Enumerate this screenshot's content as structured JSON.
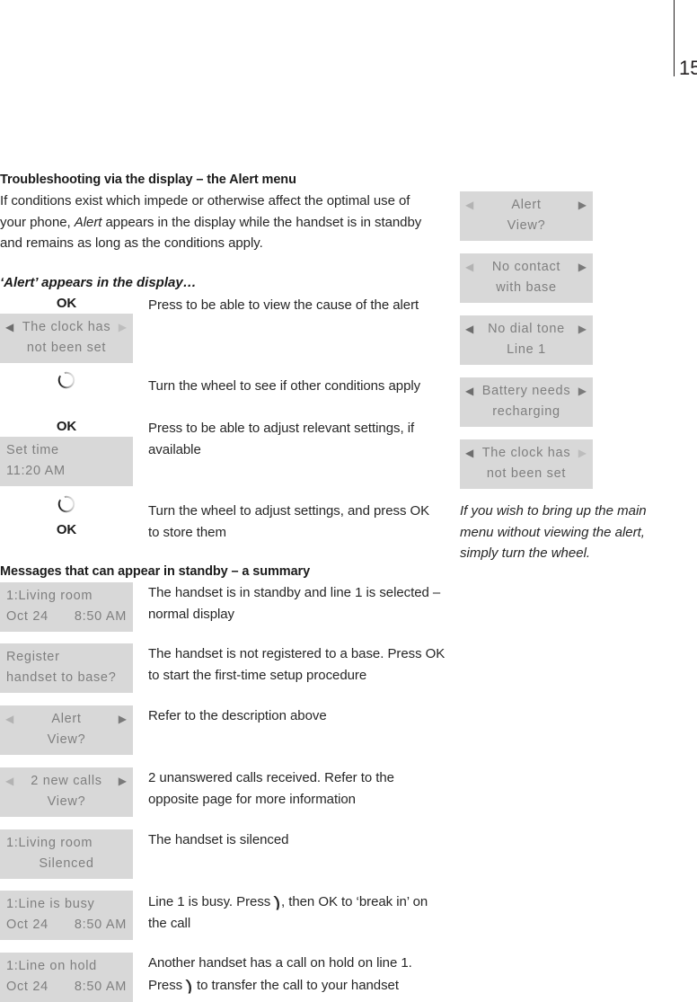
{
  "page": {
    "number": "15"
  },
  "section1": {
    "heading": "Troubleshooting via the display – the Alert menu",
    "para_a": "If conditions exist which impede or otherwise affect the optimal use of",
    "para_b_pre": "your phone, ",
    "para_b_em": "Alert",
    "para_b_post": " appears in the display while the handset is in standby",
    "para_c": "and remains as long as the conditions apply.",
    "subheading": "‘Alert’ appears in the display…"
  },
  "steps": [
    {
      "key": "OK",
      "text": "Press to be able to view the cause of the alert",
      "lcd": {
        "line1": "The clock has",
        "line2": "not been set",
        "arrows": "both"
      }
    },
    {
      "key": "wheel-icon",
      "text": "Turn the wheel to see if other conditions apply"
    },
    {
      "key": "OK",
      "text_line1": "Press to be able to adjust relevant settings, if",
      "text_line2": "available",
      "lcd": {
        "line1": "Set time",
        "line2": "11:20 AM",
        "align": "left"
      }
    },
    {
      "key": "wheel-icon",
      "key2": "OK",
      "text_line1": "Turn the wheel to adjust settings, and press OK",
      "text_line2": "to store them"
    }
  ],
  "right_column": {
    "displays": [
      {
        "line1": "Alert",
        "line2": "View?",
        "left_arrow": "light",
        "right_arrow": "dark"
      },
      {
        "line1": "No contact",
        "line2": "with base",
        "left_arrow": "light",
        "right_arrow": "dark"
      },
      {
        "line1": "No dial tone",
        "line2": "Line 1",
        "left_arrow": "dark",
        "right_arrow": "dark"
      },
      {
        "line1": "Battery needs",
        "line2": "recharging",
        "left_arrow": "dark",
        "right_arrow": "dark"
      },
      {
        "line1": "The clock has",
        "line2": "not been set",
        "left_arrow": "dark",
        "right_arrow": "light"
      }
    ],
    "note_line1": "If you wish to bring up the main",
    "note_line2": "menu without viewing the alert,",
    "note_line3": "simply turn the wheel."
  },
  "section2": {
    "heading": "Messages that can appear in standby – a summary",
    "rows": [
      {
        "lcd": {
          "type": "split",
          "line1": "1:Living room",
          "left": "Oct 24",
          "right": "8:50 AM"
        },
        "desc_line1": "The handset is in standby and line 1 is selected –",
        "desc_line2": "normal display"
      },
      {
        "lcd": {
          "type": "left",
          "line1": "Register",
          "line2": "handset to base?"
        },
        "desc_line1": "The handset is not registered to a base. Press OK",
        "desc_line2": "to start the first-time setup procedure"
      },
      {
        "lcd": {
          "type": "arrows",
          "line1": "Alert",
          "line2": "View?",
          "left_arrow": "light",
          "right_arrow": "dark"
        },
        "desc_line1": "Refer to the description above",
        "desc_line2": ""
      },
      {
        "lcd": {
          "type": "arrows",
          "line1": "2 new calls",
          "line2": "View?",
          "left_arrow": "light",
          "right_arrow": "dark"
        },
        "desc_line1": "2 unanswered calls received. Refer to the",
        "desc_line2": "opposite page for more information"
      },
      {
        "lcd": {
          "type": "mixed",
          "line1": "1:Living room",
          "line2": "Silenced"
        },
        "desc_line1": "The handset is silenced",
        "desc_line2": ""
      },
      {
        "lcd": {
          "type": "split",
          "line1": "1:Line is busy",
          "left": "Oct 24",
          "right": "8:50 AM"
        },
        "desc_line1_pre": "Line 1 is busy. Press ",
        "desc_key": "talk-key",
        "desc_line1_post": ", then OK to ‘break in’ on",
        "desc_line2": "the call"
      },
      {
        "lcd": {
          "type": "split",
          "line1": "1:Line on hold",
          "left": "Oct 24",
          "right": "8:50 AM"
        },
        "desc_line1": "Another handset has a call on hold on line 1.",
        "desc_line2_pre": "Press ",
        "desc_key": "talk-key",
        "desc_line2_post": " to transfer the call to your handset"
      }
    ]
  },
  "colors": {
    "lcd_bg": "#d8d8d8",
    "lcd_text": "#7f7f7f",
    "body_text": "#262626",
    "rule": "#231f20"
  }
}
